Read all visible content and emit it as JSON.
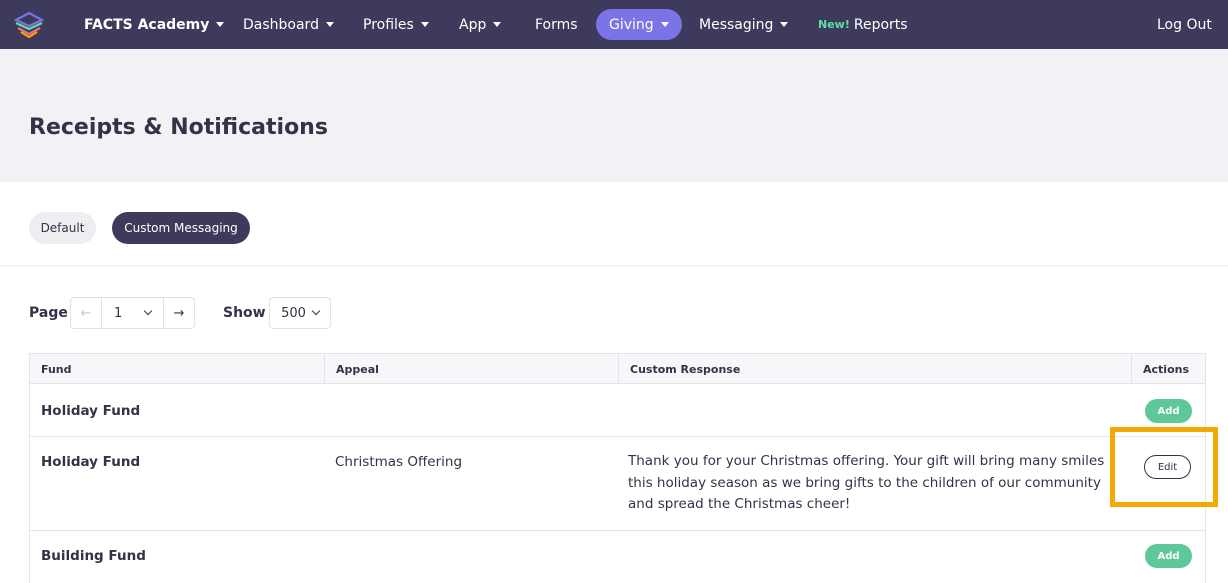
{
  "nav": {
    "brand": "FACTS Academy",
    "items": [
      {
        "label": "Dashboard"
      },
      {
        "label": "Profiles"
      },
      {
        "label": "App"
      },
      {
        "label": "Forms"
      },
      {
        "label": "Giving"
      },
      {
        "label": "Messaging"
      }
    ],
    "reports_new_tag": "New!",
    "reports_label": "Reports",
    "logout_label": "Log Out"
  },
  "page": {
    "title": "Receipts & Notifications"
  },
  "segments": {
    "default_label": "Default",
    "custom_label": "Custom Messaging",
    "active": "Custom Messaging"
  },
  "pagination": {
    "page_label": "Page",
    "page_value": "1",
    "show_label": "Show",
    "show_value": "500"
  },
  "table": {
    "headers": [
      "Fund",
      "Appeal",
      "Custom Response",
      "Actions"
    ],
    "rows": [
      {
        "fund": "Holiday Fund",
        "appeal": "",
        "response": "",
        "action": "Add"
      },
      {
        "fund": "Holiday Fund",
        "appeal": "Christmas Offering",
        "response": "Thank you for your Christmas offering. Your gift will bring many smiles this holiday season as we bring gifts to the children of our community and spread the Christmas cheer!",
        "action": "Edit"
      },
      {
        "fund": "Building Fund",
        "appeal": "",
        "response": "",
        "action": "Add"
      }
    ]
  },
  "colors": {
    "nav_bg": "#3d3a5c",
    "active_pill": "#7b74e6",
    "add_green": "#5ec898",
    "highlight": "#f2a900",
    "new_tag": "#5ee0a6"
  },
  "icons": {
    "logo": "facts-logo-icon",
    "prev": "arrow-left-icon",
    "next": "arrow-right-icon",
    "dropdown": "chevron-down-icon"
  }
}
